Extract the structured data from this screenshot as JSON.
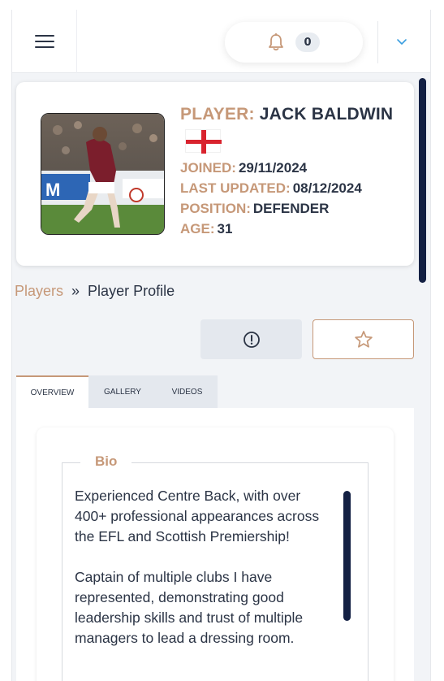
{
  "header": {
    "notification_count": "0"
  },
  "profile": {
    "player_label": "PLAYER:",
    "player_name": "JACK BALDWIN",
    "flag": "england-flag",
    "joined_label": "JOINED:",
    "joined_value": "29/11/2024",
    "updated_label": "LAST UPDATED:",
    "updated_value": "08/12/2024",
    "position_label": "POSITION:",
    "position_value": "DEFENDER",
    "age_label": "AGE:",
    "age_value": "31"
  },
  "breadcrumb": {
    "parent": "Players",
    "separator": "»",
    "current": "Player Profile"
  },
  "actions": {
    "alert_icon": "exclamation-circle-icon",
    "favourite_icon": "star-outline-icon"
  },
  "tabs": [
    {
      "label": "OVERVIEW",
      "active": true
    },
    {
      "label": "GALLERY",
      "active": false
    },
    {
      "label": "VIDEOS",
      "active": false
    }
  ],
  "bio": {
    "legend": "Bio",
    "paragraphs": [
      "Experienced Centre Back, with over 400+ professional appearances across the EFL and Scottish Premiership!",
      "Captain of multiple clubs I have represented, demonstrating good leadership skills and trust of multiple managers to lead a dressing room."
    ]
  },
  "colors": {
    "accent": "#c69878",
    "dark": "#2b3445",
    "navy": "#132043",
    "flag_red": "#d9232e"
  }
}
